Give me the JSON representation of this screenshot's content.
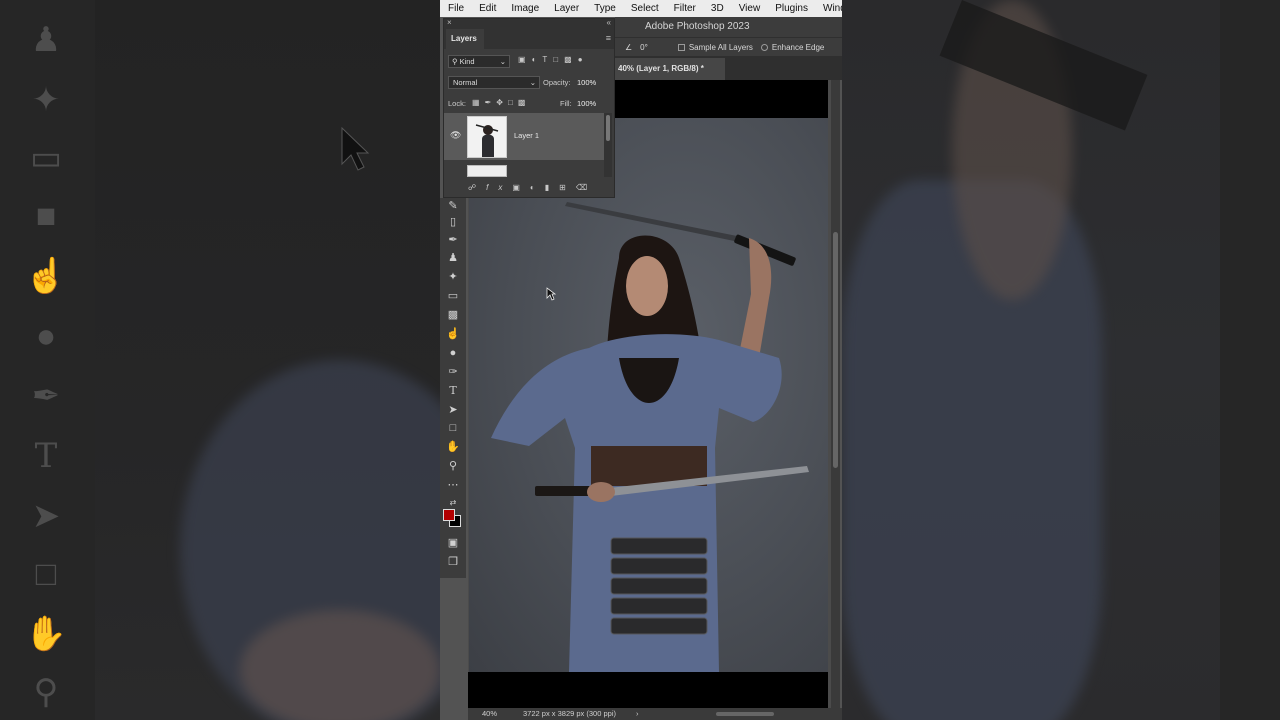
{
  "menu": [
    "File",
    "Edit",
    "Image",
    "Layer",
    "Type",
    "Select",
    "Filter",
    "3D",
    "View",
    "Plugins",
    "Window"
  ],
  "app_title": "Adobe Photoshop 2023",
  "options": {
    "angle": "0°",
    "sample_all_layers": "Sample All Layers",
    "enhance_edge": "Enhance Edge"
  },
  "document_tab": "40% (Layer 1, RGB/8) *",
  "layers_panel": {
    "tab_label": "Layers",
    "filter_kind": "Kind",
    "blend_mode": "Normal",
    "opacity_label": "Opacity:",
    "opacity_value": "100%",
    "lock_label": "Lock:",
    "fill_label": "Fill:",
    "fill_value": "100%",
    "layers": [
      {
        "name": "Layer 1",
        "visible": true,
        "selected": true
      }
    ]
  },
  "status": {
    "zoom": "40%",
    "doc_info": "3722 px x 3829 px (300 ppi)",
    "arrow": "›"
  },
  "colors": {
    "foreground": "#b30000",
    "background": "#000000",
    "workspace": "#535353"
  },
  "tools": [
    "healing-brush",
    "brush",
    "clone-stamp",
    "history-brush",
    "eraser",
    "gradient",
    "smudge",
    "dodge",
    "pen",
    "type",
    "path-selection",
    "rectangle",
    "hand",
    "zoom",
    "more"
  ]
}
